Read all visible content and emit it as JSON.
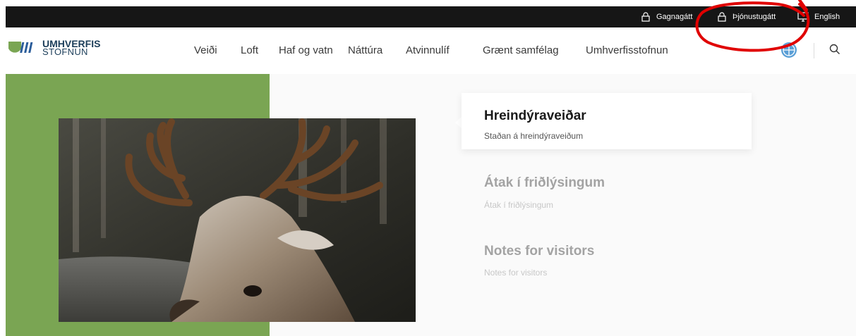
{
  "topbar": {
    "links": [
      {
        "label": "Gagnagátt",
        "icon": "lock-icon"
      },
      {
        "label": "Þjónustugátt",
        "icon": "lock-icon"
      },
      {
        "label": "English",
        "icon": "monitor-icon"
      }
    ]
  },
  "header": {
    "logo": {
      "line1": "UMHVERFIS",
      "line2": "STOFNUN"
    },
    "nav": [
      "Veiði",
      "Loft",
      "Haf og vatn",
      "Náttúra",
      "Atvinnulíf",
      "Grænt samfélag",
      "Umhverfisstofnun"
    ]
  },
  "hero": {
    "slides": [
      {
        "title": "Hreindýraveiðar",
        "subtitle": "Staðan á hreindýraveiðum",
        "active": true
      },
      {
        "title": "Átak í friðlýsingum",
        "subtitle": "Átak í friðlýsingum",
        "active": false
      },
      {
        "title": "Notes for visitors",
        "subtitle": "Notes for visitors",
        "active": false
      }
    ]
  },
  "colors": {
    "topbar": "#161616",
    "accent_green": "#7aa553",
    "logo_blue": "#1c3e5a",
    "annotation_red": "#e00000"
  }
}
